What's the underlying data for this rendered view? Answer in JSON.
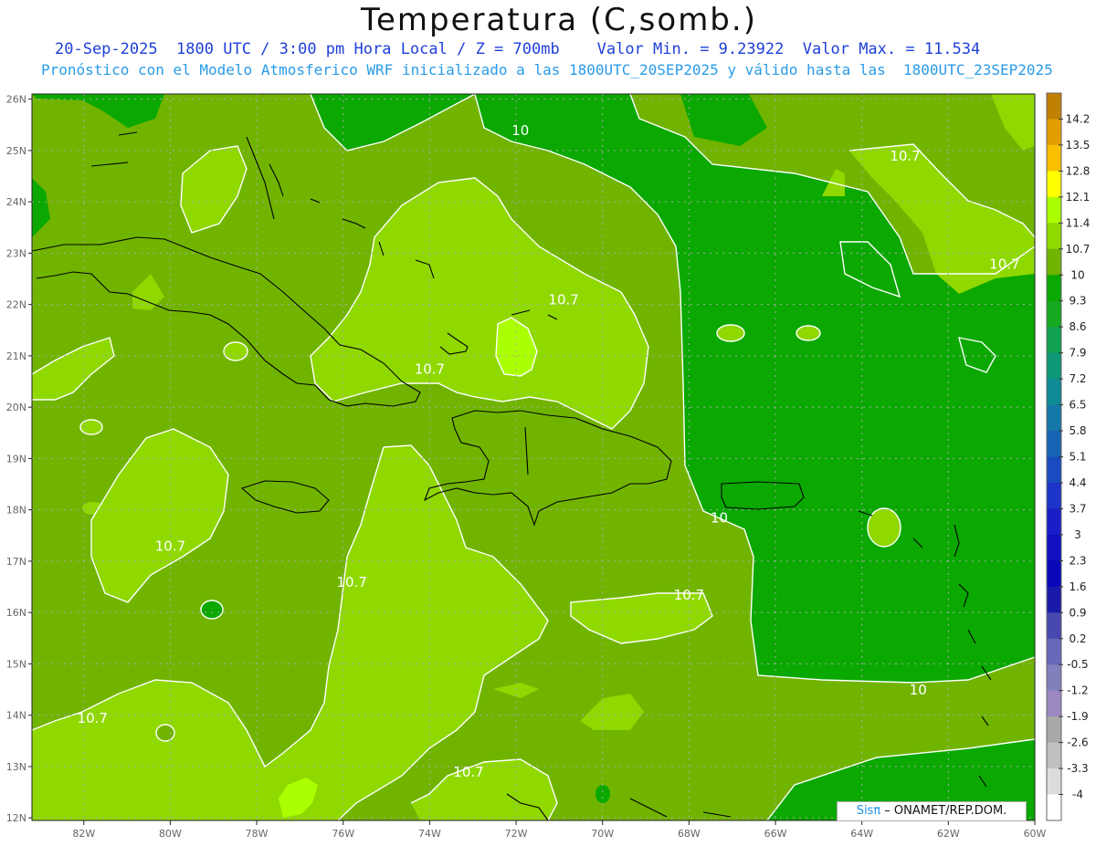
{
  "header": {
    "title": "Temperatura (C,somb.)",
    "line1": "20-Sep-2025  1800 UTC / 3:00 pm Hora Local / Z = 700mb    Valor Min. = 9.23922  Valor Max. = 11.534",
    "line2": "Pronóstico con el Modelo Atmosferico WRF inicializado a las 1800UTC_20SEP2025 y válido hasta las  1800UTC_23SEP2025"
  },
  "credit": {
    "brand": "Sisπ",
    "text": " – ONAMET/REP.DOM."
  },
  "axes": {
    "lat_labels": [
      "26N",
      "25N",
      "24N",
      "23N",
      "22N",
      "21N",
      "20N",
      "19N",
      "18N",
      "17N",
      "16N",
      "15N",
      "14N",
      "13N",
      "12N"
    ],
    "lon_labels": [
      "82W",
      "80W",
      "78W",
      "76W",
      "74W",
      "72W",
      "70W",
      "68W",
      "66W",
      "64W",
      "62W",
      "60W"
    ]
  },
  "legend": {
    "labels": [
      "14.2",
      "13.5",
      "12.8",
      "12.1",
      "11.4",
      "10.7",
      "10",
      "9.3",
      "8.6",
      "7.9",
      "7.2",
      "6.5",
      "5.8",
      "5.1",
      "4.4",
      "3.7",
      "3",
      "2.3",
      "1.6",
      "0.9",
      "0.2",
      "-0.5",
      "-1.2",
      "-1.9",
      "-2.6",
      "-3.3",
      "-4"
    ],
    "colors": [
      "#c08000",
      "#e29e00",
      "#f8c000",
      "#ffff00",
      "#aaff00",
      "#8fd800",
      "#70b400",
      "#0aa800",
      "#16a820",
      "#10a050",
      "#0e9878",
      "#0e8b94",
      "#1478a8",
      "#1862b4",
      "#1a4cc0",
      "#1c34c8",
      "#1a1ec8",
      "#1010c0",
      "#0808b8",
      "#1a1aaa",
      "#4848b0",
      "#6868b8",
      "#8080bc",
      "#9c88c0",
      "#a8a8a8",
      "#c0c0c0",
      "#dcdcdc",
      "#ffffff"
    ]
  },
  "contour_labels": [
    {
      "text": "10",
      "lon": -71.9,
      "lat": 25.3
    },
    {
      "text": "10.7",
      "lon": -63.0,
      "lat": 24.8
    },
    {
      "text": "10.7",
      "lon": -60.7,
      "lat": 22.7
    },
    {
      "text": "10.7",
      "lon": -70.9,
      "lat": 22.0
    },
    {
      "text": "10.7",
      "lon": -74.0,
      "lat": 20.65
    },
    {
      "text": "10",
      "lon": -67.3,
      "lat": 17.75
    },
    {
      "text": "10.7",
      "lon": -80.0,
      "lat": 17.2
    },
    {
      "text": "10.7",
      "lon": -75.8,
      "lat": 16.5
    },
    {
      "text": "10.7",
      "lon": -68.0,
      "lat": 16.25
    },
    {
      "text": "10",
      "lon": -62.7,
      "lat": 14.4
    },
    {
      "text": "10.7",
      "lon": -81.8,
      "lat": 13.85
    },
    {
      "text": "10.7",
      "lon": -73.1,
      "lat": 12.8
    }
  ],
  "colors": {
    "subtitle1": "#1f3fd8",
    "subtitle2": "#2a9be8",
    "grid": "#aaaaaa",
    "coast": "#000000",
    "contour": "#ffffff"
  }
}
